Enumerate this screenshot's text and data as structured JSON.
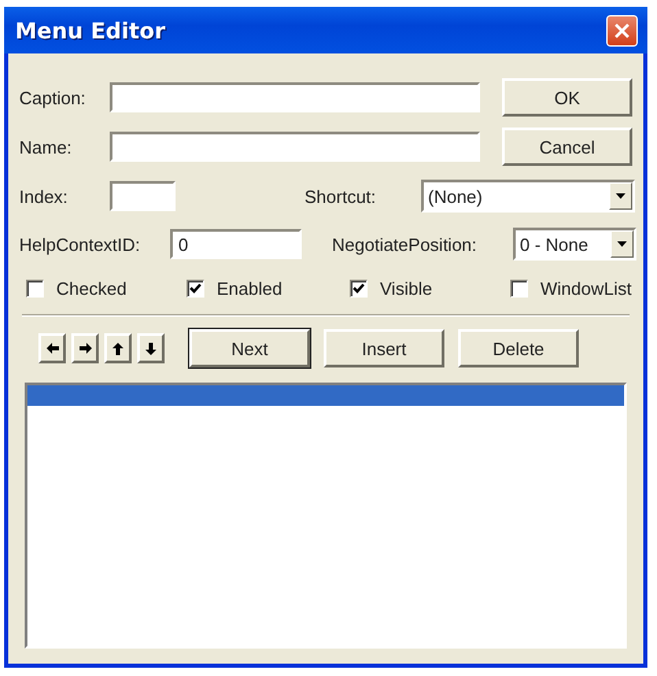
{
  "window": {
    "title": "Menu Editor"
  },
  "fields": {
    "caption": {
      "label": "Caption:"
    },
    "name": {
      "label": "Name:"
    },
    "index": {
      "label": "Index:"
    },
    "shortcut": {
      "label": "Shortcut:",
      "value": "(None)"
    },
    "help_context_id": {
      "label": "HelpContextID:",
      "value": "0"
    },
    "negotiate_position": {
      "label": "NegotiatePosition:",
      "value": "0 - None"
    }
  },
  "dialog_buttons": [
    "OK",
    "Cancel"
  ],
  "checkboxes": [
    {
      "label": "Checked",
      "checked": false
    },
    {
      "label": "Enabled",
      "checked": true
    },
    {
      "label": "Visible",
      "checked": true
    },
    {
      "label": "WindowList",
      "checked": false
    }
  ],
  "arrow_buttons": [
    {
      "kind": "left"
    },
    {
      "kind": "right"
    },
    {
      "kind": "up"
    },
    {
      "kind": "down"
    }
  ],
  "action_buttons": [
    {
      "label": "Next",
      "default": true
    },
    {
      "label": "Insert",
      "default": false
    },
    {
      "label": "Delete",
      "default": false
    }
  ],
  "menu_list": {
    "rows": [
      {
        "selected": true
      }
    ]
  }
}
